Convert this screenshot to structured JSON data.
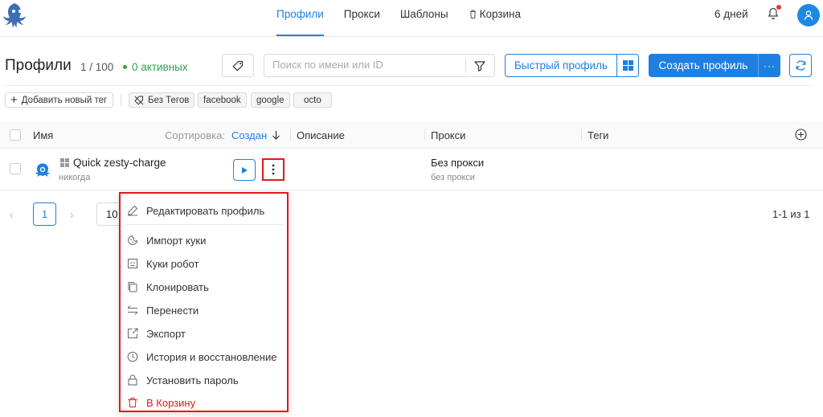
{
  "nav": {
    "items": [
      {
        "label": "Профили",
        "active": true
      },
      {
        "label": "Прокси",
        "active": false
      },
      {
        "label": "Шаблоны",
        "active": false
      },
      {
        "label": "Корзина",
        "active": false,
        "icon": "trash-icon"
      }
    ],
    "days_left": "6 дней",
    "bell_icon": "bell-icon",
    "avatar_icon": "user-icon"
  },
  "header": {
    "title": "Профили",
    "count": "1 / 100",
    "active": "0 активных",
    "search_placeholder": "Поиск по имени или ID",
    "quick_profile": "Быстрый профиль",
    "create_profile": "Создать профиль",
    "accent_color": "#1e7fe0"
  },
  "tags": {
    "add_label": "Добавить новый тег",
    "chips": [
      "Без Тегов",
      "facebook",
      "google",
      "octo"
    ]
  },
  "table": {
    "columns": {
      "name": "Имя",
      "sort_label": "Сортировка:",
      "sort_value": "Создан",
      "description": "Описание",
      "proxy": "Прокси",
      "tags": "Теги"
    },
    "rows": [
      {
        "name": "Quick zesty-charge",
        "last_run": "никогда",
        "proxy": "Без прокси",
        "proxy_sub": "без прокси"
      }
    ]
  },
  "pagination": {
    "current_page": "1",
    "page_size": "10",
    "total": "1-1 из 1"
  },
  "menu": {
    "items": [
      {
        "label": "Редактировать профиль",
        "icon": "edit-icon"
      },
      {
        "label": "Импорт куки",
        "icon": "cookie-icon"
      },
      {
        "label": "Куки робот",
        "icon": "robot-icon"
      },
      {
        "label": "Клонировать",
        "icon": "copy-icon"
      },
      {
        "label": "Перенести",
        "icon": "transfer-icon"
      },
      {
        "label": "Экспорт",
        "icon": "export-icon"
      },
      {
        "label": "История и восстановление",
        "icon": "history-icon"
      },
      {
        "label": "Установить пароль",
        "icon": "lock-icon"
      },
      {
        "label": "В Корзину",
        "icon": "trash-icon",
        "danger": true
      }
    ]
  }
}
